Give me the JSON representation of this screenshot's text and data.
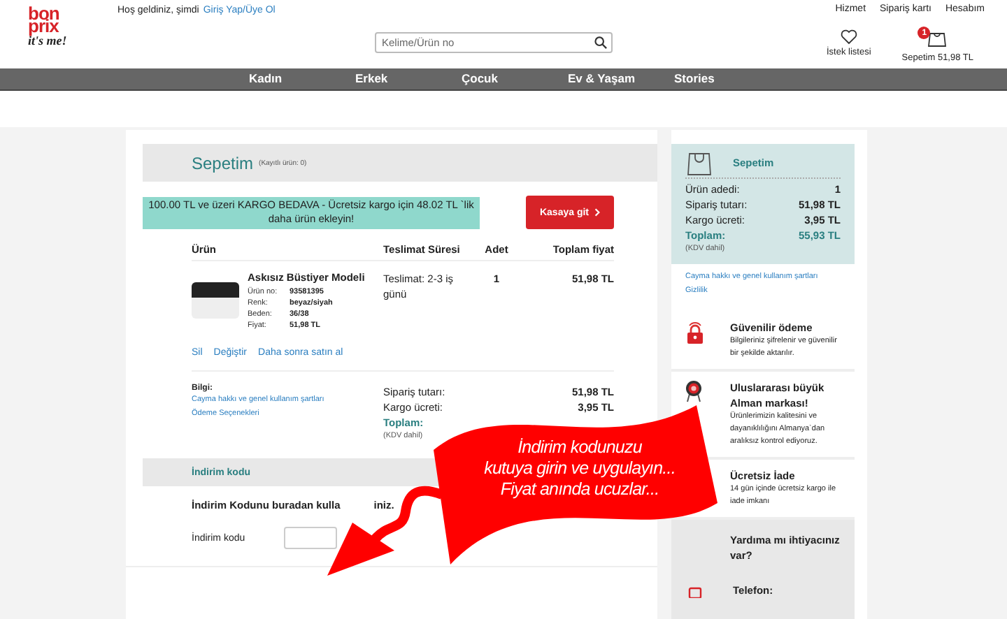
{
  "logo": {
    "lines": [
      "bon",
      "prix"
    ],
    "tagline": "it's me!"
  },
  "header": {
    "greeting": "Hoş geldiniz, şimdi",
    "login_link": "Giriş Yap/Üye Ol",
    "top_links": [
      "Hizmet",
      "Sipariş kartı",
      "Hesabım"
    ],
    "search": {
      "placeholder": "Kelime/Ürün no"
    },
    "wishlist": "İstek listesi",
    "cart": {
      "label": "Sepetim 51,98 TL",
      "badge": "1"
    }
  },
  "nav": [
    "Kadın",
    "Erkek",
    "Çocuk",
    "Ev & Yaşam",
    "Stories"
  ],
  "cart": {
    "title": "Sepetim",
    "subtitle": "(Kayıtlı ürün: 0)",
    "promo": "100.00 TL ve üzeri KARGO BEDAVA - Ücretsiz kargo için 48.02 TL `lik daha ürün ekleyin!",
    "checkout_button": "Kasaya git",
    "columns": [
      "Ürün",
      "Teslimat Süresi",
      "Adet",
      "Toplam fiyat"
    ],
    "items": [
      {
        "name": "Askısız Büstiyer Modeli",
        "details": [
          {
            "label": "Ürün no:",
            "value": "93581395"
          },
          {
            "label": "Renk:",
            "value": "beyaz/siyah"
          },
          {
            "label": "Beden:",
            "value": "36/38"
          },
          {
            "label": "Fiyat:",
            "value": "51,98 TL"
          }
        ],
        "delivery": "Teslimat: 2-3 iş günü",
        "quantity": "1",
        "total": "51,98 TL"
      }
    ],
    "actions": [
      "Sil",
      "Değiştir",
      "Daha sonra satın al"
    ],
    "info": {
      "label": "Bilgi:",
      "links": [
        "Cayma hakkı ve genel kullanım şartları",
        "Ödeme Seçenekleri"
      ]
    },
    "summary": [
      {
        "kind": "plain",
        "label": "Sipariş tutarı:",
        "value": "51,98 TL"
      },
      {
        "kind": "plain",
        "label": "Kargo ücreti:",
        "value": "3,95 TL"
      },
      {
        "kind": "total",
        "label": "Toplam:"
      }
    ],
    "summary_note": "(KDV dahil)"
  },
  "discount": {
    "title": "İndirim kodu",
    "instruction_parts": [
      "İndirim Kodunu buradan kulla",
      "iniz."
    ],
    "field_label": "İndirim kodu"
  },
  "sidebar": {
    "title": "Sepetim",
    "rows": [
      {
        "kind": "plain",
        "label": "Ürün adedi:",
        "value": "1"
      },
      {
        "kind": "plain",
        "label": "Sipariş tutarı:",
        "value": "51,98 TL"
      },
      {
        "kind": "plain",
        "label": "Kargo ücreti:",
        "value": "3,95 TL"
      },
      {
        "kind": "total",
        "label": "Toplam:",
        "value": "55,93 TL"
      }
    ],
    "note": "(KDV dahil)",
    "links": [
      "Cayma hakkı ve genel kullanım şartları",
      "Gizlilik"
    ],
    "features": [
      {
        "kind": "lock",
        "title": "Güvenilir ödeme",
        "text": "Bilgileriniz şifrelenir ve güvenilir bir şekilde aktarılır."
      },
      {
        "kind": "rosette",
        "title": "Uluslararası büyük Alman markası!",
        "text": "Ürünlerimizin kalitesini ve dayanıklılığını Almanya`dan aralıksız kontrol ediyoruz."
      },
      {
        "kind": "none",
        "title": "Ücretsiz İade",
        "text": "14 gün içinde ücretsiz kargo ile iade imkanı"
      }
    ],
    "help_title": "Yardıma mı ihtiyacınız var?",
    "phone_label": "Telefon:"
  },
  "callout": {
    "lines": [
      "İndirim kodunuzu",
      "kutuya girin ve uygulayın...",
      "Fiyat anında ucuzlar..."
    ]
  }
}
